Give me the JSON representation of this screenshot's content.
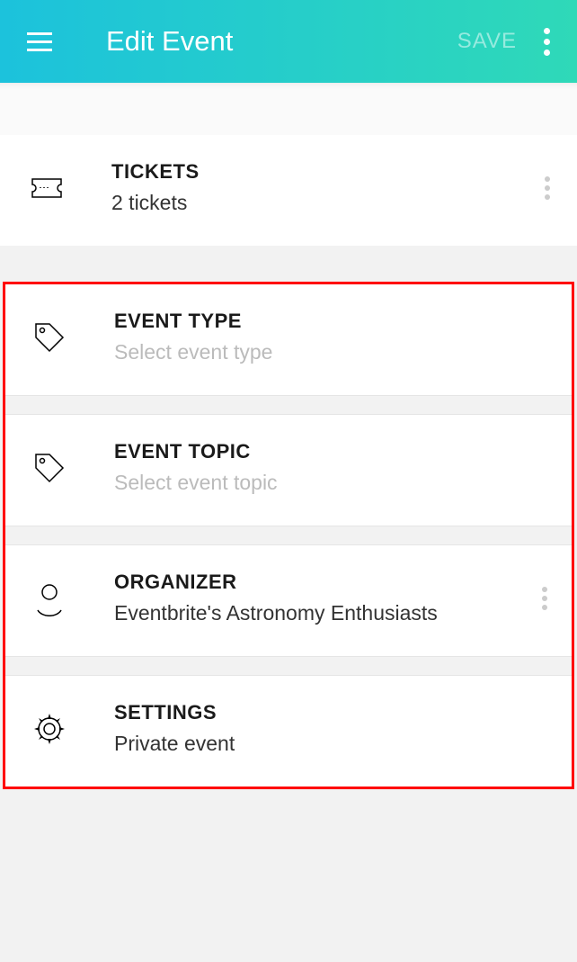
{
  "header": {
    "title": "Edit Event",
    "save_label": "SAVE"
  },
  "tickets": {
    "label": "TICKETS",
    "value": "2 tickets"
  },
  "event_type": {
    "label": "EVENT TYPE",
    "placeholder": "Select event type"
  },
  "event_topic": {
    "label": "EVENT TOPIC",
    "placeholder": "Select event topic"
  },
  "organizer": {
    "label": "ORGANIZER",
    "value": "Eventbrite's Astronomy Enthusiasts"
  },
  "settings": {
    "label": "SETTINGS",
    "value": "Private event"
  }
}
